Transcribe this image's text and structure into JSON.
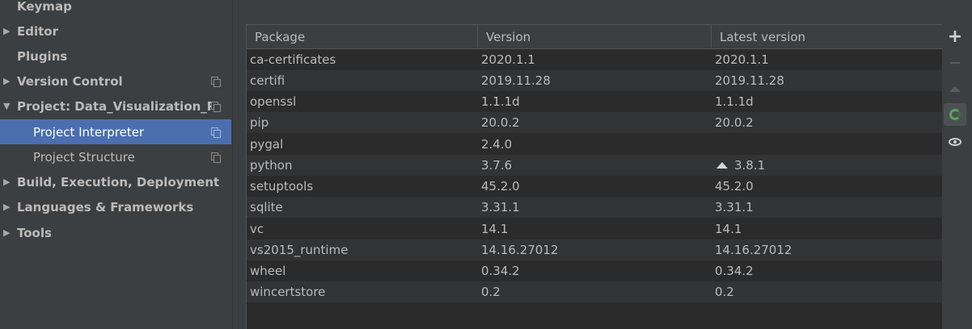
{
  "sidebar": {
    "items": [
      {
        "label": "Keymap"
      },
      {
        "label": "Editor"
      },
      {
        "label": "Plugins"
      },
      {
        "label": "Version Control"
      },
      {
        "label": "Project: Data_Visualization_Pr..."
      },
      {
        "label": "Project Interpreter"
      },
      {
        "label": "Project Structure"
      },
      {
        "label": "Build, Execution, Deployment"
      },
      {
        "label": "Languages & Frameworks"
      },
      {
        "label": "Tools"
      }
    ]
  },
  "table": {
    "headers": {
      "package": "Package",
      "version": "Version",
      "latest": "Latest version"
    },
    "rows": [
      {
        "package": "ca-certificates",
        "version": "2020.1.1",
        "latest": "2020.1.1"
      },
      {
        "package": "certifi",
        "version": "2019.11.28",
        "latest": "2019.11.28"
      },
      {
        "package": "openssl",
        "version": "1.1.1d",
        "latest": "1.1.1d"
      },
      {
        "package": "pip",
        "version": "20.0.2",
        "latest": "20.0.2"
      },
      {
        "package": "pygal",
        "version": "2.4.0",
        "latest": ""
      },
      {
        "package": "python",
        "version": "3.7.6",
        "latest": "3.8.1"
      },
      {
        "package": "setuptools",
        "version": "45.2.0",
        "latest": "45.2.0"
      },
      {
        "package": "sqlite",
        "version": "3.31.1",
        "latest": "3.31.1"
      },
      {
        "package": "vc",
        "version": "14.1",
        "latest": "14.1"
      },
      {
        "package": "vs2015_runtime",
        "version": "14.16.27012",
        "latest": "14.16.27012"
      },
      {
        "package": "wheel",
        "version": "0.34.2",
        "latest": "0.34.2"
      },
      {
        "package": "wincertstore",
        "version": "0.2",
        "latest": "0.2"
      }
    ]
  },
  "toolbar": {
    "icons": [
      "plus-icon",
      "minus-icon",
      "up-arrow-icon",
      "loading-spinner-icon",
      "eye-icon"
    ]
  },
  "colors": {
    "background": "#3c3f41",
    "table_background": "#2b2b2b",
    "selection": "#4b6eaf",
    "text": "#bbbbbb",
    "spinner": "#5aa35a"
  }
}
